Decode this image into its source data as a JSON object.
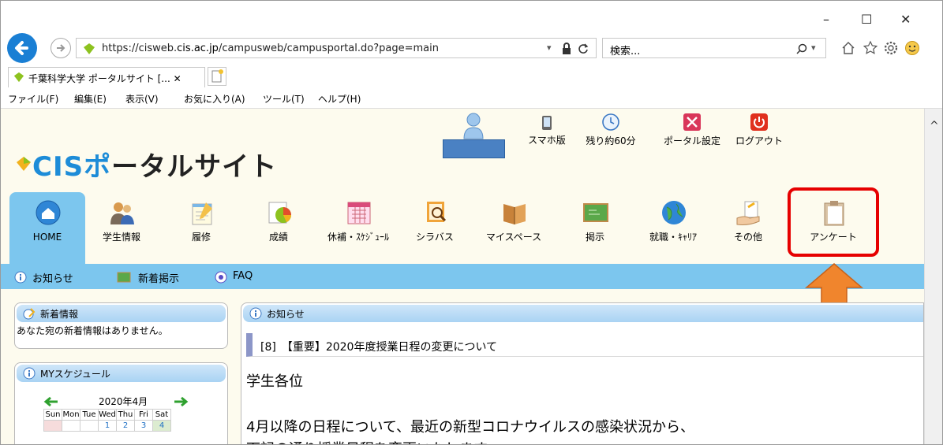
{
  "browser": {
    "window_controls": {
      "minimize": "–",
      "maximize": "☐",
      "close": "✕"
    },
    "url_prefix": "https://cisweb.",
    "url_host": "cis.ac.jp",
    "url_suffix": "/campusweb/campusportal.do?page=main",
    "search_placeholder": "検索...",
    "tab_title": "千葉科学大学 ポータルサイト [... ✕",
    "menu": [
      "ファイル(F)",
      "編集(E)",
      "表示(V)",
      "お気に入り(A)",
      "ツール(T)",
      "ヘルプ(H)"
    ]
  },
  "header": {
    "logo_a": "CIS",
    "logo_b": "ポ",
    "logo_c": "ータルサイト",
    "utilities": [
      "スマホ版",
      "残り約60分",
      "ポータル設定",
      "ログアウト"
    ]
  },
  "nav": [
    "HOME",
    "学生情報",
    "履修",
    "成績",
    "休補・ｽｹｼﾞｭｰﾙ",
    "シラバス",
    "マイスペース",
    "掲示",
    "就職・ｷｬﾘｱ",
    "その他",
    "アンケート"
  ],
  "subnav": [
    "お知らせ",
    "新着掲示",
    "FAQ"
  ],
  "sidebar": {
    "news_title": "新着情報",
    "news_body": "あなた宛の新着情報はありません。",
    "schedule_title": "MYスケジュール",
    "month": "2020年4月",
    "weekdays": [
      "Sun",
      "Mon",
      "Tue",
      "Wed",
      "Thu",
      "Fri",
      "Sat"
    ],
    "first_row": [
      "",
      "",
      "",
      "1",
      "2",
      "3",
      "4"
    ]
  },
  "main": {
    "panel_title": "お知らせ",
    "item": "[8]　【重要】2020年度授業日程の変更について",
    "greeting": "学生各位",
    "body": "4月以降の日程について、最近の新型コロナウイルスの感染状況から、",
    "body2": "下記の通り授業日程を変更いたします"
  },
  "colors": {
    "accent": "#1d8cd8",
    "highlight": "#e60000",
    "arrow": "#f0852d",
    "subbar": "#7cc6ee"
  }
}
